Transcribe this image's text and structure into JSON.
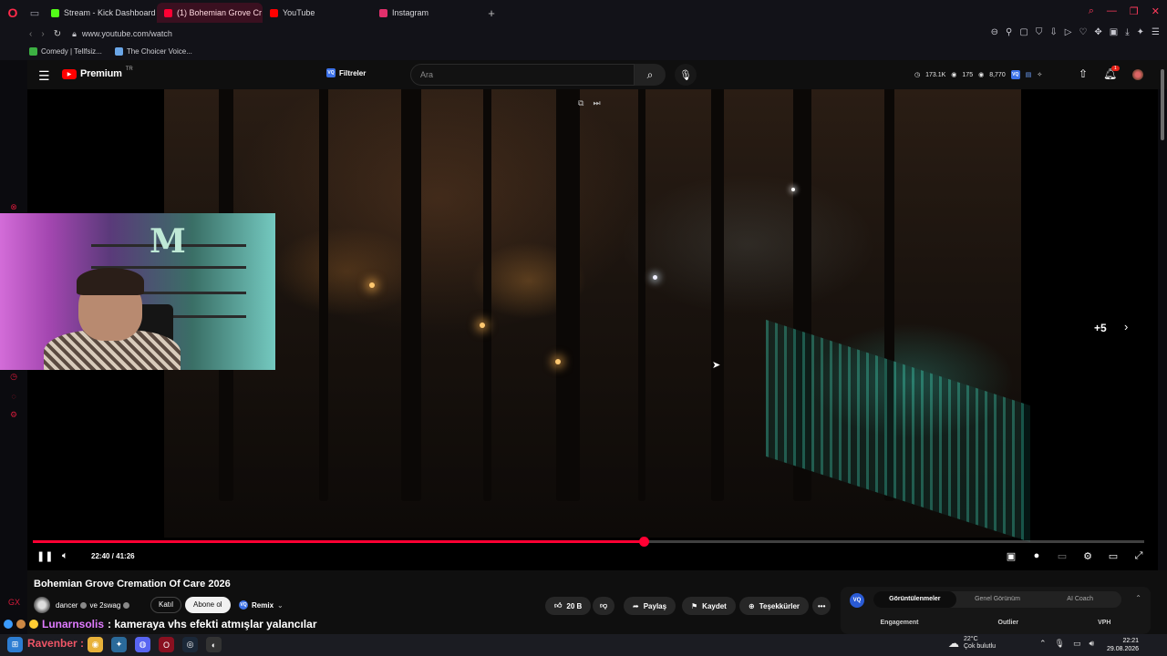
{
  "browser": {
    "tabs": [
      {
        "label": "Stream - Kick Dashboard",
        "color": "#53fc18"
      },
      {
        "label": "(1) Bohemian Grove Cr",
        "color": "#ff0033"
      },
      {
        "label": "YouTube",
        "color": "#ff0000"
      },
      {
        "label": "Instagram",
        "color": "#e1306c"
      }
    ],
    "url": "www.youtube.com/watch",
    "bookmarks": [
      {
        "label": "Comedy | Tellfsiz..."
      },
      {
        "label": "The Choicer Voice..."
      }
    ]
  },
  "youtube": {
    "logo_text": "Premium",
    "logo_sup": "TR",
    "filters_label": "Filtreler",
    "filters_badge": "VQ",
    "search_placeholder": "Ara",
    "stats": {
      "views": "173.1K",
      "eye1": "175",
      "eye2": "8,770"
    },
    "notification_count": "1"
  },
  "video": {
    "overlay_more": "+5",
    "time_current": "22:40",
    "time_total": "41:26",
    "time_display": "22:40 / 41:26",
    "progress": 0.55
  },
  "below_video": {
    "title": "Bohemian Grove Cremation Of Care 2026",
    "channel": "dancer",
    "channel_collab": "ve 2swag",
    "join_label": "Katıl",
    "subscribe_label": "Abone ol",
    "remix_label": "Remix",
    "like_count": "20 B",
    "share_label": "Paylaş",
    "save_label": "Kaydet",
    "thanks_label": "Teşekkürler",
    "more_label": "•••"
  },
  "side_panel": {
    "badge": "VQ",
    "tabs": [
      "Görüntülenmeler",
      "Genel Görünüm",
      "AI Coach"
    ],
    "columns": [
      "Engagement",
      "Outlier",
      "VPH"
    ]
  },
  "chat": {
    "username": "Lunarnsolis",
    "message": ": kameraya vhs efekti atmışlar yalancılar"
  },
  "taskbar": {
    "streamer": "Ravenber :",
    "weather_temp": "22°C",
    "weather_desc": "Çok bulutlu",
    "time": "22:21",
    "date": "29.08.2026"
  }
}
